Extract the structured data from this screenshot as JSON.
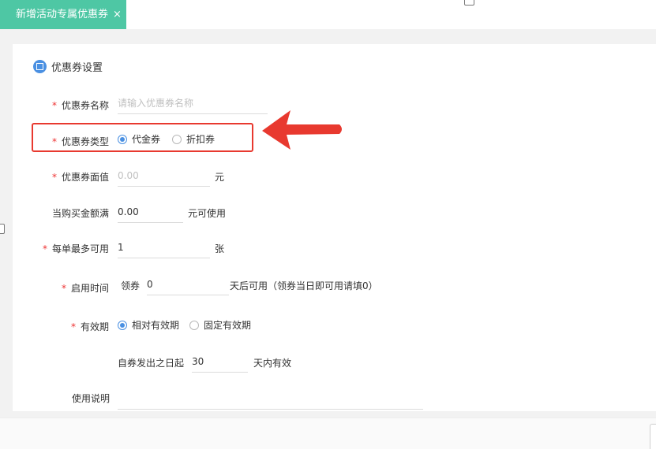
{
  "tab": {
    "title": "新增活动专属优惠券",
    "close": "×"
  },
  "section": {
    "title": "优惠券设置"
  },
  "form": {
    "name": {
      "label": "优惠券名称",
      "required": "*",
      "placeholder": "请输入优惠券名称",
      "value": ""
    },
    "type": {
      "label": "优惠券类型",
      "required": "*",
      "options": [
        "代金券",
        "折扣券"
      ],
      "selected": "代金券"
    },
    "face_value": {
      "label": "优惠券面值",
      "required": "*",
      "placeholder": "0.00",
      "value": "",
      "unit": "元"
    },
    "min_purchase": {
      "label": "当购买金额满",
      "value": "0.00",
      "unit": "元可使用"
    },
    "max_per_order": {
      "label": "每单最多可用",
      "required": "*",
      "value": "1",
      "unit": "张"
    },
    "start_time": {
      "label": "启用时间",
      "required": "*",
      "prefix": "领券",
      "value": "0",
      "unit": "天后可用（领券当日即可用请填0）"
    },
    "validity": {
      "label": "有效期",
      "required": "*",
      "options": [
        "相对有效期",
        "固定有效期"
      ],
      "selected": "相对有效期",
      "prefix": "自券发出之日起",
      "value": "30",
      "unit": "天内有效"
    },
    "usage_note": {
      "label": "使用说明",
      "value": ""
    }
  },
  "colors": {
    "accent": "#4a90e2",
    "tab": "#4ec7a4",
    "highlight": "#e8392f",
    "required": "#ee3333"
  }
}
